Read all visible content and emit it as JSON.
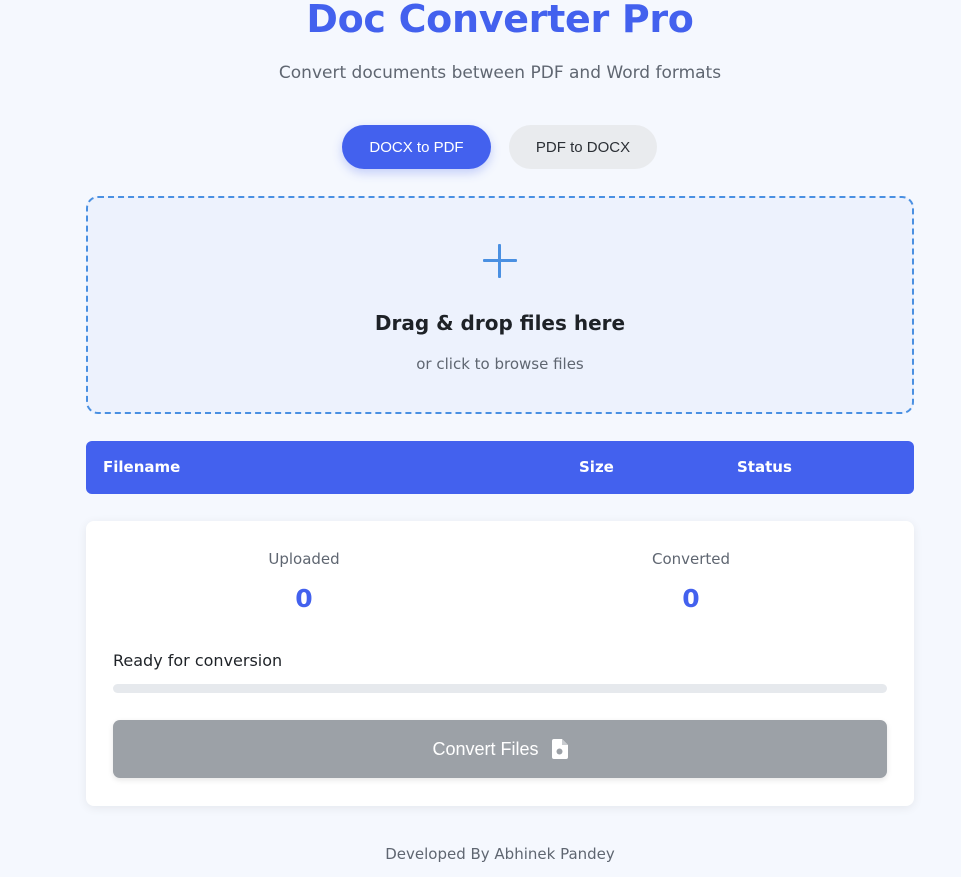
{
  "header": {
    "title": "Doc Converter Pro",
    "subtitle": "Convert documents between PDF and Word formats"
  },
  "mode_toggle": {
    "docx_to_pdf_label": "DOCX to PDF",
    "pdf_to_docx_label": "PDF to DOCX",
    "active": "DOCX to PDF"
  },
  "dropzone": {
    "icon": "plus-icon",
    "title": "Drag & drop files here",
    "subtitle": "or click to browse files"
  },
  "file_table": {
    "columns": [
      "Filename",
      "Size",
      "Status"
    ]
  },
  "stats": {
    "uploaded_label": "Uploaded",
    "uploaded_value": "0",
    "converted_label": "Converted",
    "converted_value": "0",
    "status_text": "Ready for conversion",
    "progress_percent": 0
  },
  "convert": {
    "label": "Convert Files",
    "icon": "file-icon",
    "disabled": true
  },
  "footer": {
    "text": "Developed By Abhinek Pandey"
  },
  "colors": {
    "accent": "#4361ee",
    "dropzone_border": "#4a90e2",
    "disabled_button": "#9ca1a7",
    "background": "#f5f8fe"
  }
}
